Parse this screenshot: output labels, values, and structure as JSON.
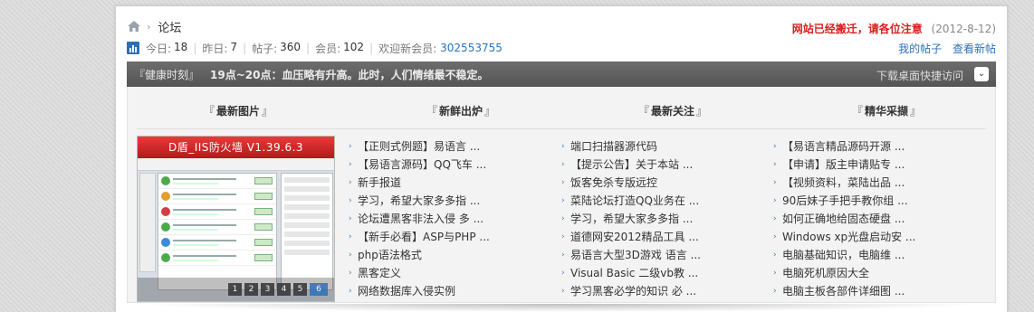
{
  "header": {
    "breadcrumb_label": "论坛",
    "stats": [
      {
        "label": "今日:",
        "value": "18"
      },
      {
        "label": "昨日:",
        "value": "7"
      },
      {
        "label": "帖子:",
        "value": "360"
      },
      {
        "label": "会员:",
        "value": "102"
      }
    ],
    "welcome_label": "欢迎新会员:",
    "welcome_user": "302553755",
    "notice": "网站已经搬迁，请各位注意",
    "notice_date": "(2012-8-12)",
    "link_my_posts": "我的帖子",
    "link_new_posts": "查看新帖"
  },
  "tip_bar": {
    "title": "『健康时刻』",
    "text": "19点~20点：血压略有升高。此时，人们情绪最不稳定。",
    "download_label": "下载桌面快捷访问",
    "toggle_glyph": "⌄"
  },
  "columns": [
    {
      "heading": "最新图片"
    },
    {
      "heading": "新鲜出炉"
    },
    {
      "heading": "最新关注"
    },
    {
      "heading": "精华采撷"
    }
  ],
  "slideshow": {
    "title": "D盾_IIS防火墙 V1.39.6.3",
    "pages": [
      "1",
      "2",
      "3",
      "4",
      "5",
      "6"
    ],
    "active_page": "6"
  },
  "lists": {
    "fresh": [
      "【正则式例题】易语言 ...",
      "【易语言源码】QQ飞车 ...",
      "新手报道",
      "学习，希望大家多多指 ...",
      "论坛遭黑客非法入侵 多 ...",
      "【新手必看】ASP与PHP ...",
      "php语法格式",
      "黑客定义",
      "网络数据库入侵实例"
    ],
    "attention": [
      "端口扫描器源代码",
      "【提示公告】关于本站 ...",
      "饭客免杀专版远控",
      "菜陆论坛打造QQ业务在 ...",
      "学习，希望大家多多指 ...",
      "道德网安2012精品工具 ...",
      "易语言大型3D游戏 语言 ...",
      "Visual Basic 二级vb教 ...",
      "学习黑客必学的知识 必 ..."
    ],
    "essence": [
      "【易语言精品源码开源 ...",
      "【申请】版主申请贴专 ...",
      "【视频资料，菜陆出品 ...",
      "90后妹子手把手教你组 ...",
      "如何正确地给固态硬盘 ...",
      "Windows xp光盘启动安 ...",
      "电脑基础知识，电脑维 ...",
      "电脑死机原因大全",
      "电脑主板各部件详细图 ..."
    ]
  }
}
